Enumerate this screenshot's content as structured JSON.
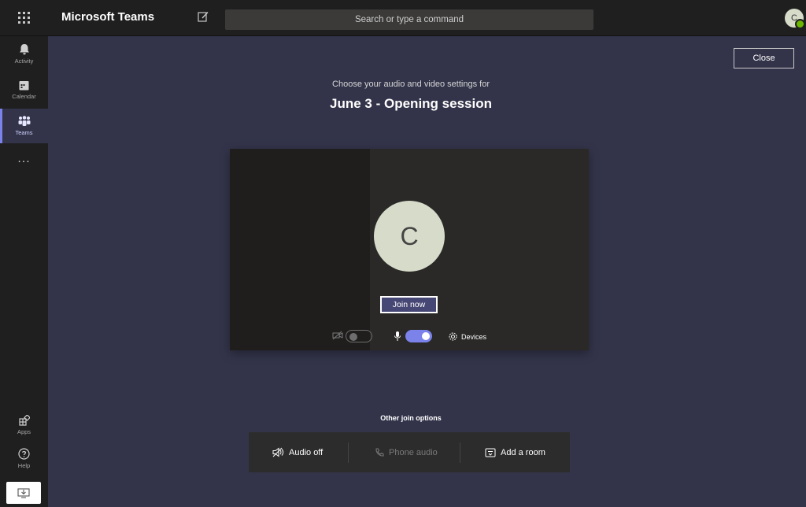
{
  "app": {
    "title": "Microsoft Teams"
  },
  "search": {
    "placeholder": "Search or type a command"
  },
  "user": {
    "initial": "C"
  },
  "rail": {
    "items": [
      {
        "label": "Activity",
        "icon": "bell-icon"
      },
      {
        "label": "Calendar",
        "icon": "calendar-icon"
      },
      {
        "label": "Teams",
        "icon": "teams-icon",
        "active": true
      },
      {
        "label": "...",
        "icon": "more-icon"
      }
    ],
    "bottom": [
      {
        "label": "Apps",
        "icon": "apps-icon"
      },
      {
        "label": "Help",
        "icon": "help-icon"
      }
    ]
  },
  "prejoin": {
    "close_label": "Close",
    "subtitle": "Choose your audio and video settings for",
    "meeting_title": "June 3 - Opening session",
    "avatar_initial": "C",
    "join_label": "Join now",
    "camera_on": false,
    "mic_on": true,
    "devices_label": "Devices"
  },
  "other_options": {
    "title": "Other join options",
    "items": [
      {
        "label": "Audio off",
        "icon": "speaker-off-icon",
        "enabled": true
      },
      {
        "label": "Phone audio",
        "icon": "phone-icon",
        "enabled": false
      },
      {
        "label": "Add a room",
        "icon": "room-icon",
        "enabled": true
      }
    ]
  },
  "colors": {
    "accent": "#7b83eb",
    "join_button": "#464775",
    "background": "#33344a",
    "rail": "#1f1f1f",
    "presence": "#6bb700"
  }
}
